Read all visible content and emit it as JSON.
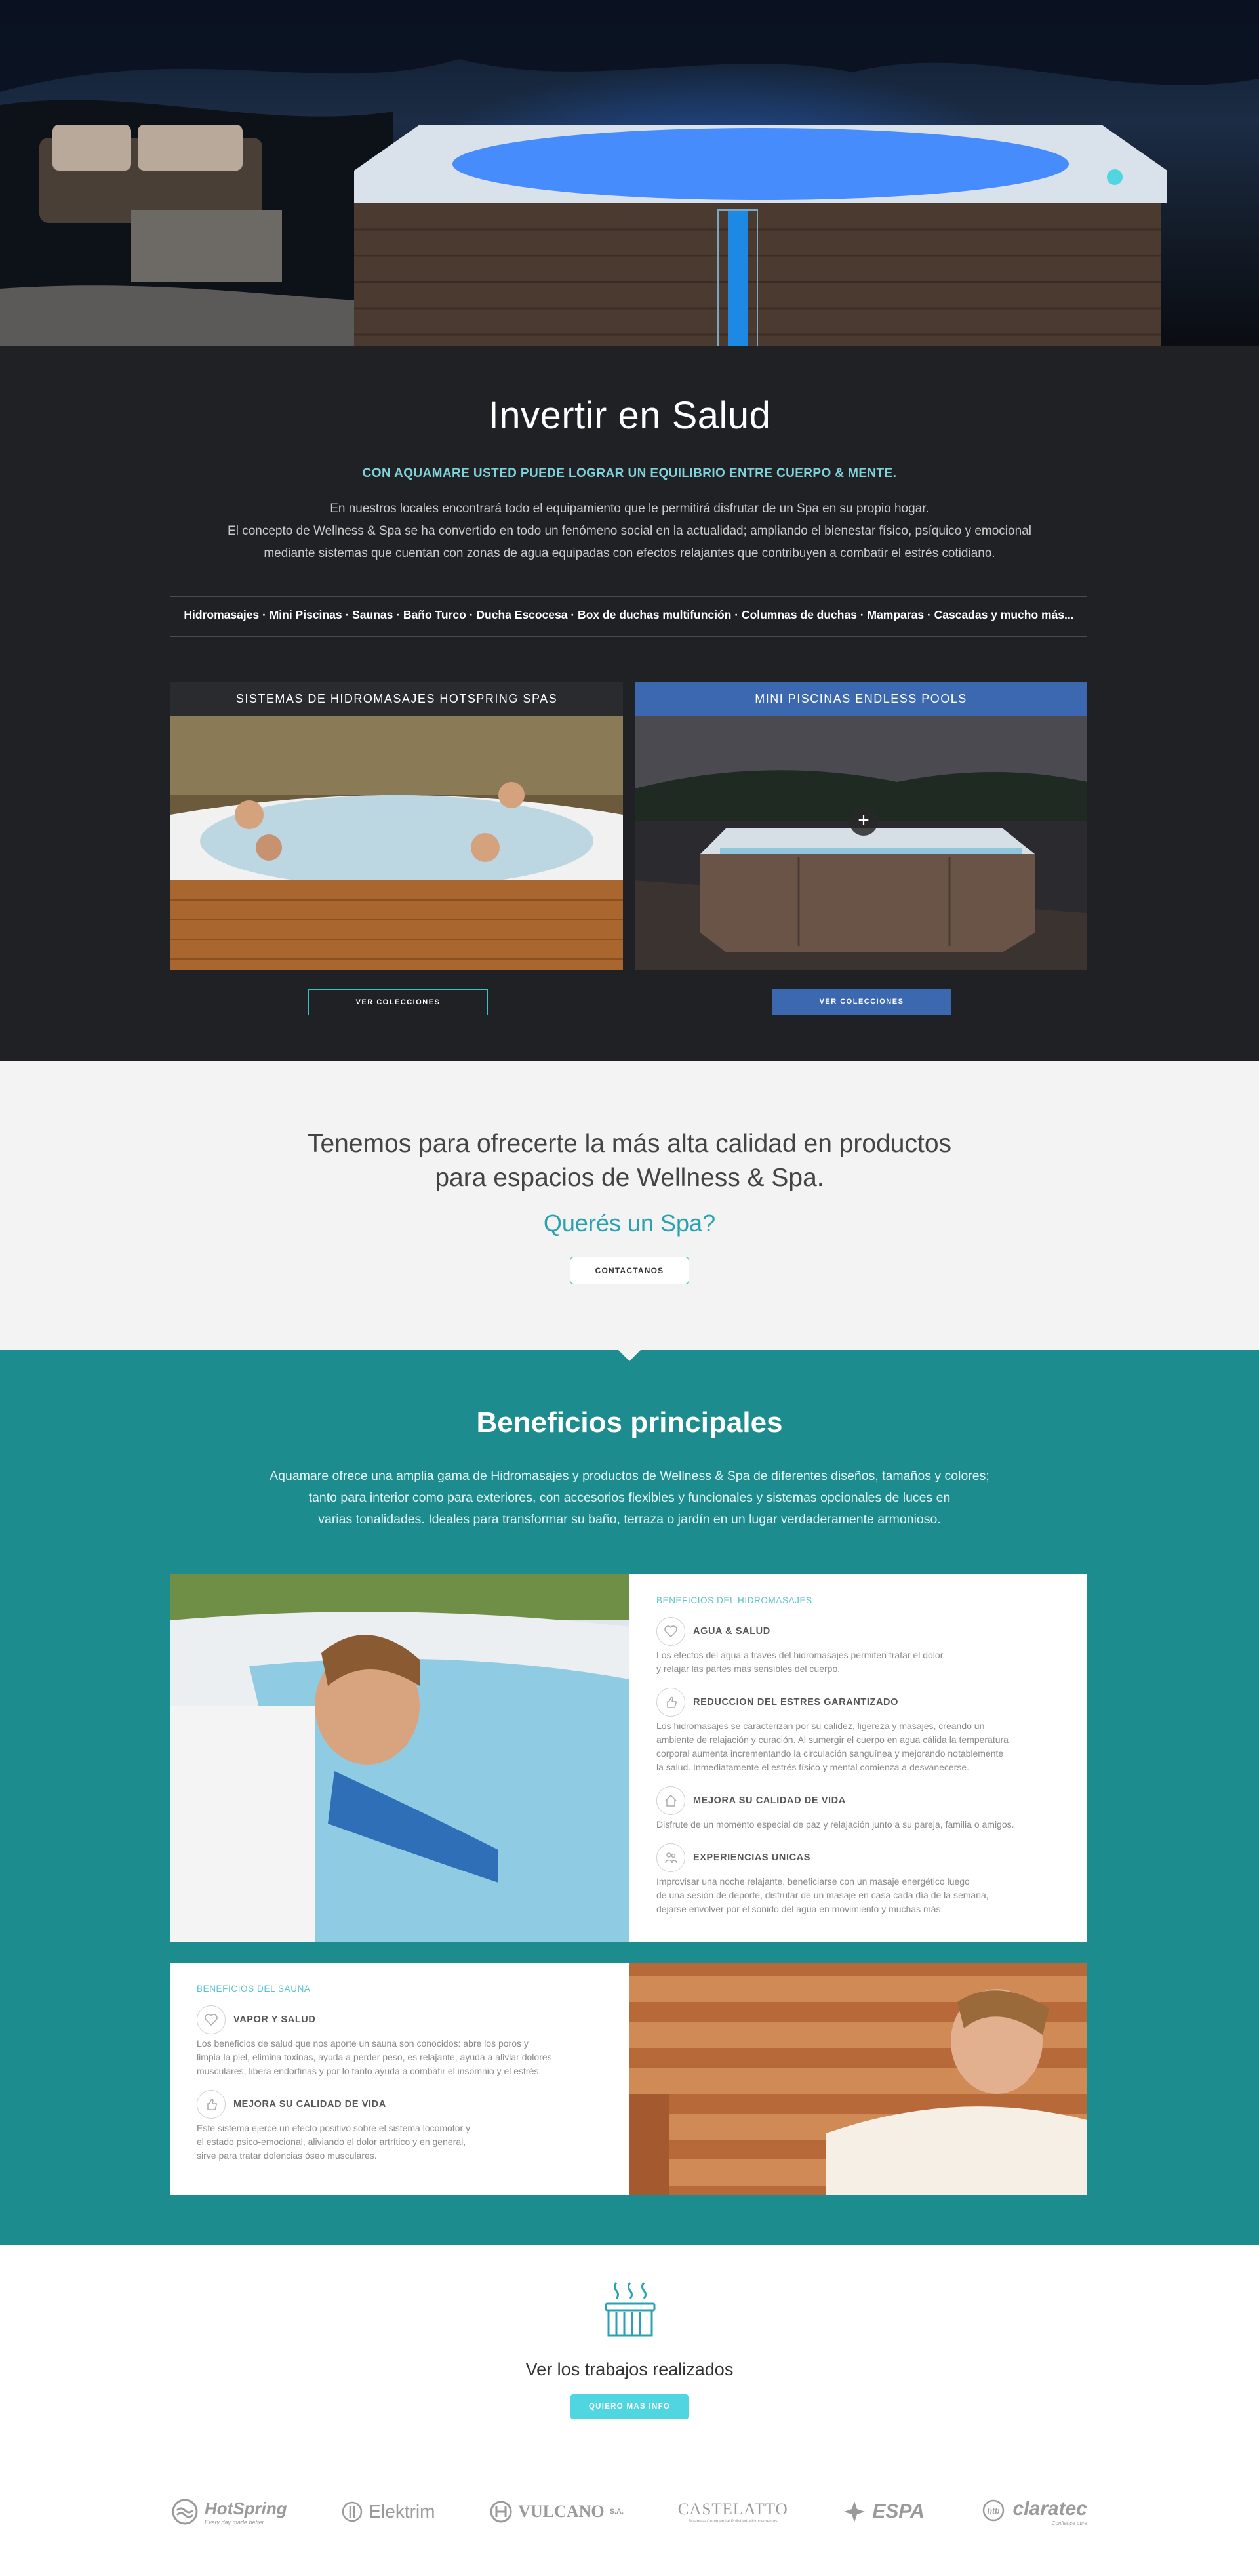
{
  "invest": {
    "title": "Invertir en Salud",
    "subtitle": "CON AQUAMARE USTED PUEDE LOGRAR UN EQUILIBRIO ENTRE CUERPO & MENTE.",
    "lines": [
      "En nuestros locales encontrará todo el equipamiento que le permitirá disfrutar de un Spa en su propio hogar.",
      "El concepto de Wellness & Spa se ha convertido en todo un fenómeno social en la actualidad; ampliando el bienestar físico, psíquico y emocional",
      "mediante sistemas que cuentan con zonas de agua equipadas con efectos relajantes que contribuyen a combatir el estrés cotidiano."
    ],
    "products": "Hidromasajes · Mini Piscinas · Saunas · Baño Turco · Ducha Escocesa · Box de duchas multifunción · Columnas de duchas · Mamparas · Cascadas y mucho más..."
  },
  "cards": [
    {
      "title": "SISTEMAS DE HIDROMASAJES HOTSPRING SPAS",
      "button": "VER COLECCIONES",
      "color": "#2a2b2f"
    },
    {
      "title": "MINI PISCINAS ENDLESS POOLS",
      "button": "VER COLECCIONES",
      "color": "#3b68ae",
      "overlay_icon": "plus-icon"
    }
  ],
  "quality": {
    "line1": "Tenemos para ofrecerte la más alta calidad en productos",
    "line2": "para espacios de Wellness & Spa.",
    "link": "Querés un Spa?",
    "button": "CONTACTANOS"
  },
  "benefits": {
    "title": "Beneficios principales",
    "lines": [
      "Aquamare ofrece una amplia gama de Hidromasajes y productos de Wellness & Spa de diferentes diseños, tamaños y colores;",
      "tanto para interior como para exteriores, con accesorios flexibles y funcionales y sistemas opcionales de luces en",
      "varias tonalidades. Ideales para transformar su baño, terraza o jardín en un lugar verdaderamente armonioso."
    ],
    "hydro": {
      "kicker": "BENEFICIOS DEL HIDROMASAJES",
      "items": [
        {
          "icon": "heart-icon",
          "title": "AGUA & SALUD",
          "lines": [
            "Los efectos del agua a través del hidromasajes permiten tratar el dolor",
            "y relajar las partes más sensibles del cuerpo."
          ]
        },
        {
          "icon": "thumbs-up-icon",
          "title": "REDUCCION DEL ESTRES GARANTIZADO",
          "lines": [
            "Los hidromasajes se caracterizan por su calidez, ligereza y masajes, creando un",
            "ambiente de relajación y curación. Al sumergir el cuerpo en agua cálida la temperatura",
            "corporal aumenta incrementando la circulación sanguínea y mejorando notablemente",
            "la salud. Inmediatamente el estrés físico y mental comienza a desvanecerse."
          ]
        },
        {
          "icon": "home-icon",
          "title": "MEJORA SU CALIDAD DE VIDA",
          "lines": [
            "Disfrute de un momento especial de paz y relajación junto a su pareja, familia o amigos."
          ]
        },
        {
          "icon": "people-icon",
          "title": "EXPERIENCIAS UNICAS",
          "lines": [
            "Improvisar una noche relajante, beneficiarse con un masaje energético luego",
            "de una sesión de deporte, disfrutar de un masaje en casa cada día de la semana,",
            "dejarse envolver por el sonido del agua en movimiento y muchas más."
          ]
        }
      ]
    },
    "sauna": {
      "kicker": "BENEFICIOS DEL SAUNA",
      "items": [
        {
          "icon": "heart-icon",
          "title": "VAPOR Y SALUD",
          "lines": [
            "Los beneficios de salud que nos aporte un sauna son conocidos: abre los poros y",
            "limpia la piel, elimina toxinas, ayuda a perder peso, es relajante, ayuda a aliviar dolores",
            "musculares, libera endorfinas y por lo tanto ayuda a combatir el insomnio y el estrés."
          ]
        },
        {
          "icon": "thumbs-up-icon",
          "title": "MEJORA SU CALIDAD DE VIDA",
          "lines": [
            "Este sistema ejerce un efecto positivo sobre el sistema locomotor y",
            "el estado psico-emocional, aliviando el dolor artrítico y en general,",
            "sirve para tratar dolencias óseo musculares."
          ]
        }
      ]
    }
  },
  "works": {
    "icon": "hot-tub-icon",
    "title": "Ver los trabajos realizados",
    "button": "QUIERO MAS INFO"
  },
  "logos": [
    {
      "name": "HotSpring",
      "tagline": "Every day made better"
    },
    {
      "name": "Elektrim",
      "tagline": ""
    },
    {
      "name": "VULCANO",
      "tagline": "S.A."
    },
    {
      "name": "CASTELATTO",
      "tagline": "Business Commercial Polished Microcementos"
    },
    {
      "name": "ESPA",
      "tagline": ""
    },
    {
      "name": "claratec",
      "tagline": "Confiance pure"
    }
  ],
  "colors": {
    "dark": "#202124",
    "accent_teal": "#1c8c8e",
    "accent_cyan": "#4fd6e0",
    "blue": "#3b68ae"
  }
}
